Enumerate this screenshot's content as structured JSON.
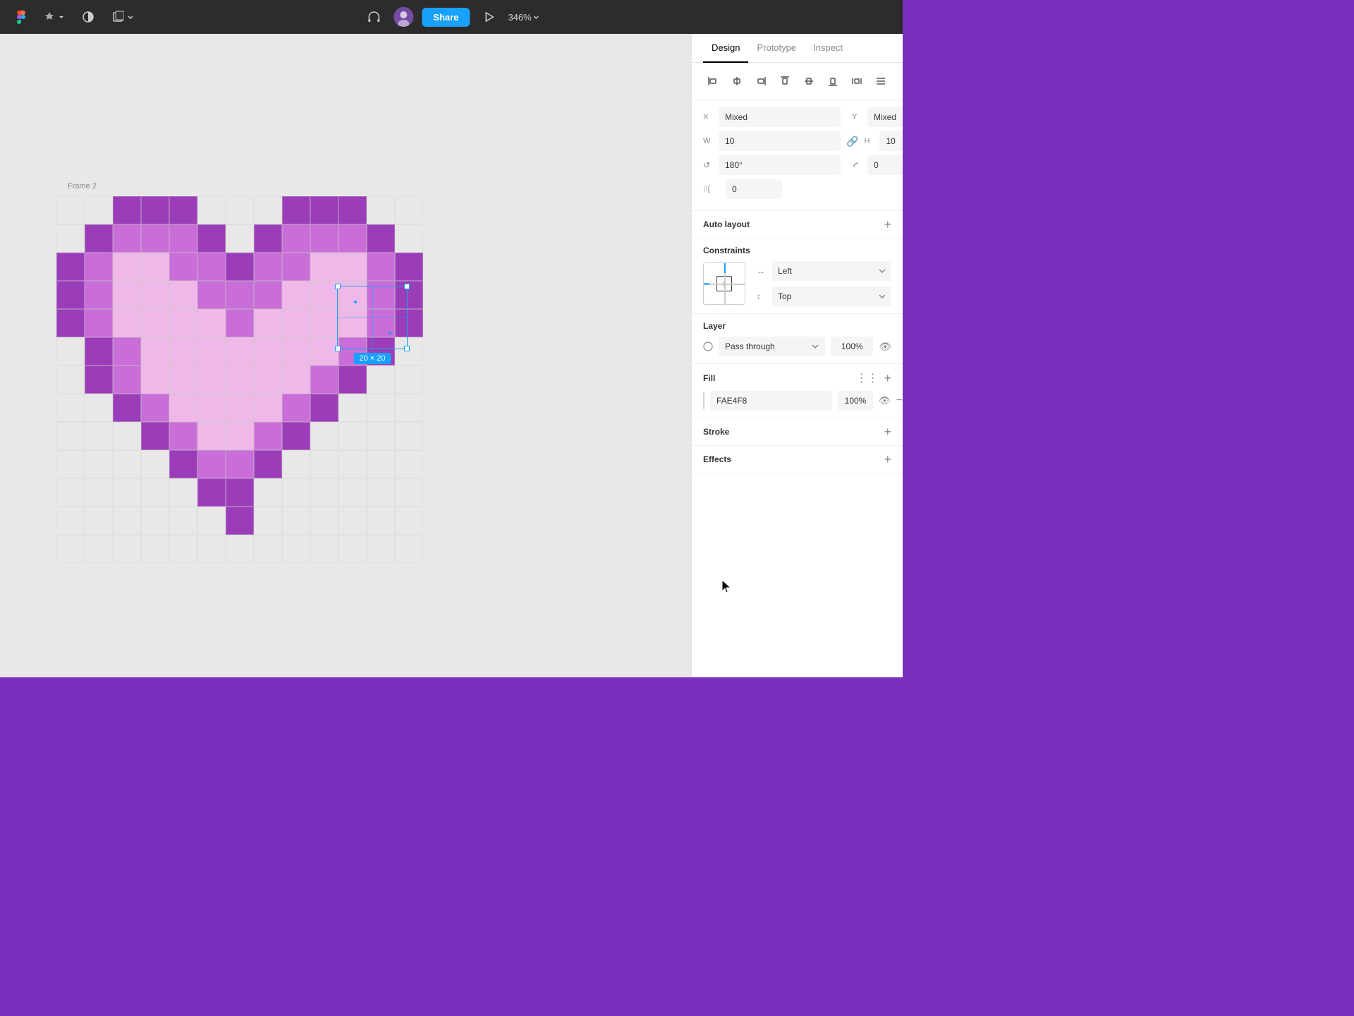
{
  "topbar": {
    "zoom_level": "346%",
    "share_label": "Share",
    "tabs": [
      "Design",
      "Prototype",
      "Inspect"
    ]
  },
  "canvas": {
    "frame_label": "Frame 2",
    "selection_size": "20 × 20"
  },
  "design_panel": {
    "tabs": [
      "Design",
      "Prototype",
      "Inspect"
    ],
    "active_tab": "Design",
    "position": {
      "x_label": "X",
      "x_value": "Mixed",
      "y_label": "Y",
      "y_value": "Mixed"
    },
    "dimensions": {
      "w_label": "W",
      "w_value": "10",
      "h_label": "H",
      "h_value": "10"
    },
    "rotation": {
      "label": "180°"
    },
    "corner_radius": {
      "label": "0"
    },
    "clip": {
      "label": "0"
    },
    "auto_layout": {
      "label": "Auto layout"
    },
    "constraints": {
      "label": "Constraints",
      "horizontal": "Left",
      "vertical": "Top"
    },
    "layer": {
      "label": "Layer",
      "blend_mode": "Pass through",
      "opacity": "100%"
    },
    "fill": {
      "label": "Fill",
      "color": "#FAE4F8",
      "hex": "FAE4F8",
      "opacity": "100%"
    },
    "stroke": {
      "label": "Stroke"
    },
    "effects": {
      "label": "Effects"
    }
  },
  "pixel_colors": {
    "dark_purple": "#9B3DB8",
    "mid_purple": "#C96DD8",
    "light_pink": "#F0B8E8",
    "lightest_pink": "#FAE4F8",
    "white": "#FFFFFF"
  }
}
